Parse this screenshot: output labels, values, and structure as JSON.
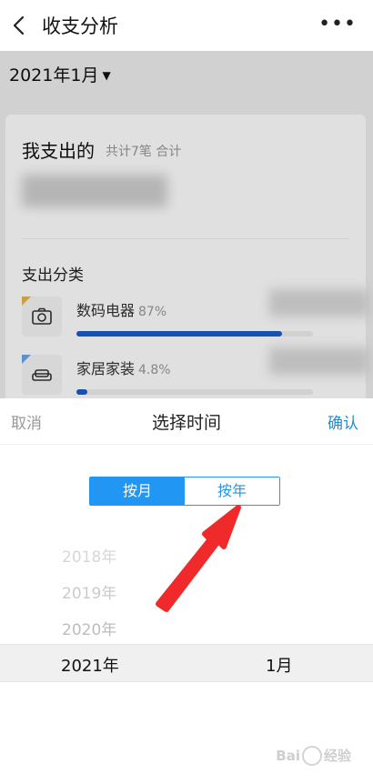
{
  "header": {
    "title": "收支分析",
    "more_glyph": "•••"
  },
  "page": {
    "month_select": "2021年1月",
    "card": {
      "title": "我支出的",
      "subtitle": "共计7笔 合计",
      "category_title": "支出分类",
      "categories": [
        {
          "icon": "camera-icon",
          "name": "数码电器",
          "percent": "87%",
          "fraction": 0.87
        },
        {
          "icon": "sofa-icon",
          "name": "家居家装",
          "percent": "4.8%",
          "fraction": 0.048
        }
      ]
    }
  },
  "picker": {
    "cancel_label": "取消",
    "title": "选择时间",
    "confirm_label": "确认",
    "tabs": {
      "by_month": "按月",
      "by_year": "按年"
    },
    "years": [
      "2018年",
      "2019年",
      "2020年"
    ],
    "selected_year": "2021年",
    "selected_month": "1月"
  },
  "colors": {
    "accent": "#2196f3",
    "confirm": "#1a8fe0",
    "annotation_arrow": "#f02a2a"
  }
}
